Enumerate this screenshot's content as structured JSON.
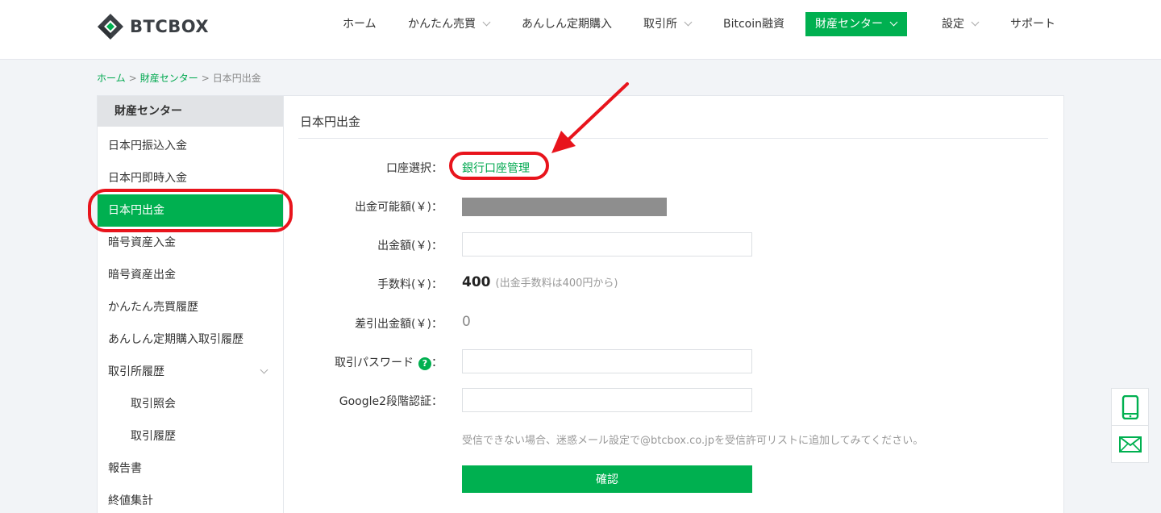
{
  "brand": {
    "name_prefix": "BTC",
    "name_suffix": "BOX",
    "accent": "#00b050",
    "annotation": "#e8141c"
  },
  "nav": {
    "items": [
      {
        "label": "ホーム",
        "dropdown": false
      },
      {
        "label": "かんたん売買",
        "dropdown": true
      },
      {
        "label": "あんしん定期購入",
        "dropdown": false
      },
      {
        "label": "取引所",
        "dropdown": true
      },
      {
        "label": "Bitcoin融資",
        "dropdown": false
      },
      {
        "label": "財産センター",
        "dropdown": true,
        "active": true
      },
      {
        "label": "設定",
        "dropdown": true
      },
      {
        "label": "サポート",
        "dropdown": false
      }
    ]
  },
  "breadcrumb": {
    "home": "ホーム",
    "section": "財産センター",
    "current": "日本円出金",
    "separator": ">"
  },
  "sidebar": {
    "title": "財産センター",
    "items": [
      {
        "label": "日本円振込入金"
      },
      {
        "label": "日本円即時入金"
      },
      {
        "label": "日本円出金",
        "active": true
      },
      {
        "label": "暗号資産入金"
      },
      {
        "label": "暗号資産出金"
      },
      {
        "label": "かんたん売買履歴"
      },
      {
        "label": "あんしん定期購入取引履歴"
      },
      {
        "label": "取引所履歴",
        "expandable": true
      },
      {
        "label": "取引照会",
        "sub": true
      },
      {
        "label": "取引履歴",
        "sub": true
      },
      {
        "label": "報告書"
      },
      {
        "label": "終値集計"
      }
    ]
  },
  "form": {
    "title": "日本円出金",
    "account_label": "口座選択：",
    "account_link": "銀行口座管理",
    "available_label": "出金可能額(￥)：",
    "amount_label": "出金額(￥)：",
    "amount_value": "",
    "fee_label": "手数料(￥)：",
    "fee_value": "400",
    "fee_note": "(出金手数料は400円から)",
    "net_label": "差引出金額(￥)：",
    "net_value": "0",
    "password_label": "取引パスワード",
    "password_help": "?",
    "password_suffix": "：",
    "google_label": "Google2段階認証：",
    "note": "受信できない場合、迷惑メール設定で@btcbox.co.jpを受信許可リストに追加してみてください。",
    "confirm_label": "確認"
  },
  "float_widget": {
    "icons": [
      "phone-icon",
      "mail-icon"
    ]
  }
}
